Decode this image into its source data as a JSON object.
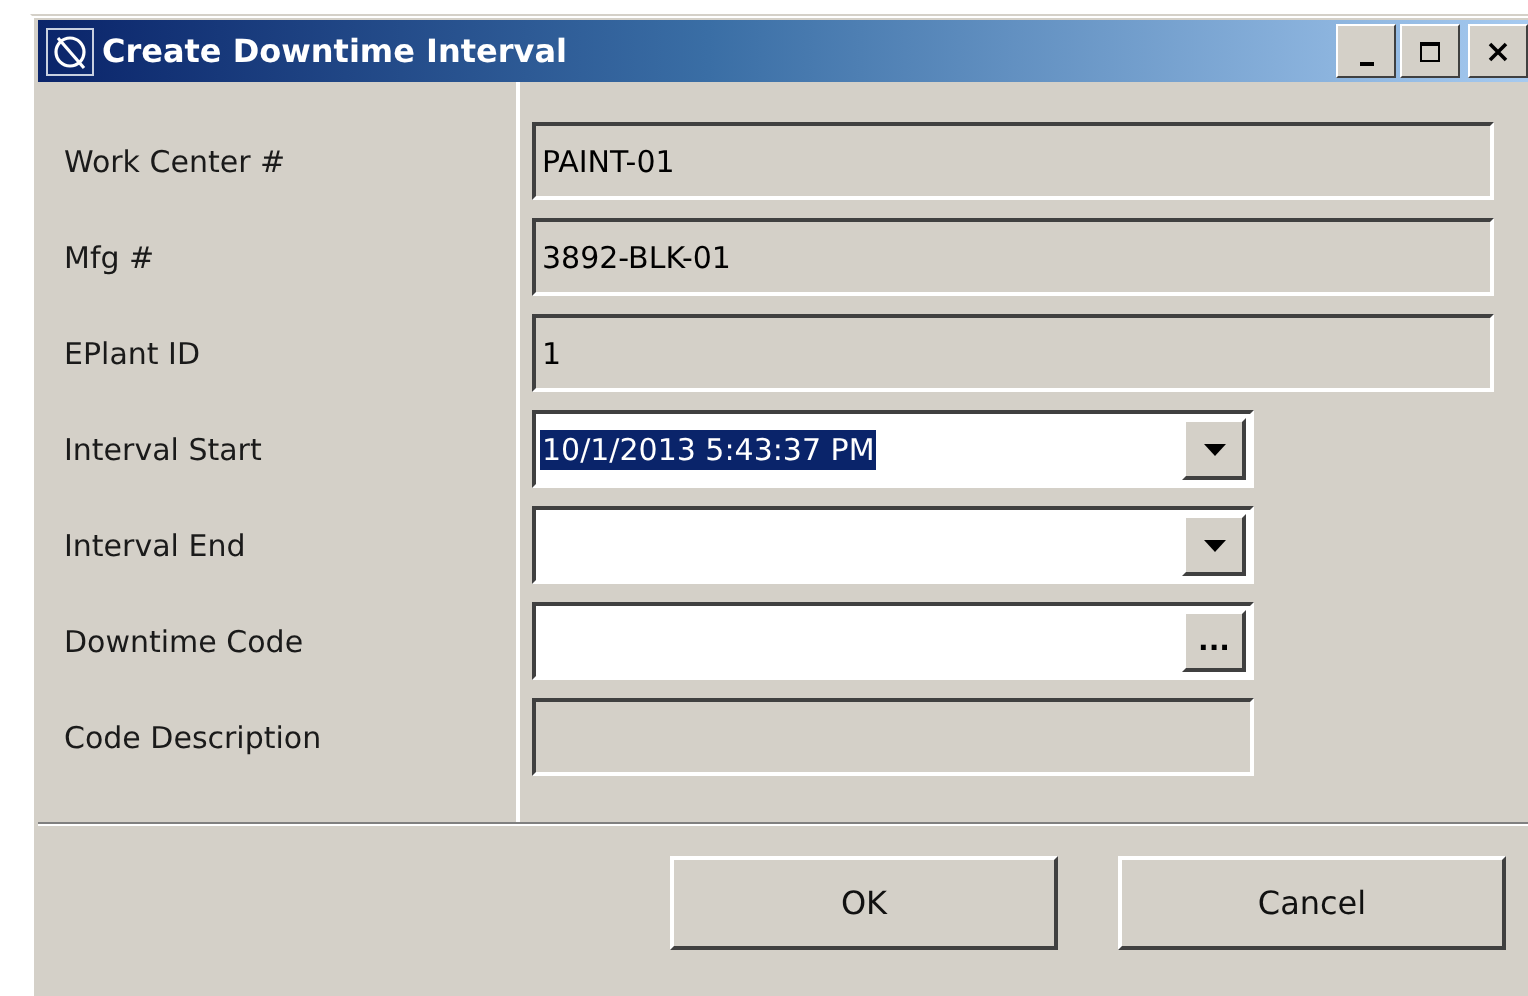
{
  "window": {
    "title": "Create Downtime Interval"
  },
  "fields": [
    {
      "label": "Work Center #",
      "kind": "info",
      "value": "PAINT-01"
    },
    {
      "label": "Mfg #",
      "kind": "info",
      "value": "3892-BLK-01"
    },
    {
      "label": "EPlant ID",
      "kind": "info",
      "value": "1"
    },
    {
      "label": "Interval Start",
      "kind": "date",
      "value": "10/1/2013 5:43:37 PM",
      "text_selected": true
    },
    {
      "label": "Interval End",
      "kind": "date"
    },
    {
      "label": "Downtime Code",
      "kind": "lookup",
      "button": "..."
    },
    {
      "label": "Code Description",
      "kind": "description"
    }
  ],
  "buttons": [
    "OK",
    "Cancel"
  ]
}
